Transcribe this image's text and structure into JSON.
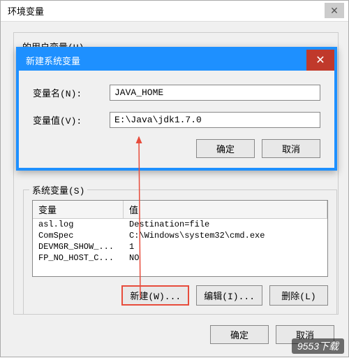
{
  "outer": {
    "title": "环境变量",
    "close_glyph": "✕",
    "partial_text": "的用户变量(U)"
  },
  "modal": {
    "title": "新建系统变量",
    "close_glyph": "✕",
    "name_label": "变量名(N):",
    "value_label": "变量值(V):",
    "name_value": "JAVA_HOME",
    "value_value": "E:\\Java\\jdk1.7.0",
    "ok_label": "确定",
    "cancel_label": "取消"
  },
  "sysvar": {
    "legend": "系统变量(S)",
    "header_var": "变量",
    "header_val": "值",
    "rows": [
      {
        "var": "asl.log",
        "val": "Destination=file"
      },
      {
        "var": "ComSpec",
        "val": "C:\\Windows\\system32\\cmd.exe"
      },
      {
        "var": "DEVMGR_SHOW_...",
        "val": "1"
      },
      {
        "var": "FP_NO_HOST_C...",
        "val": "NO"
      }
    ],
    "new_label": "新建(W)...",
    "edit_label": "编辑(I)...",
    "delete_label": "删除(L)"
  },
  "bottom": {
    "ok_label": "确定",
    "cancel_label": "取消"
  },
  "watermark": "9553下载"
}
